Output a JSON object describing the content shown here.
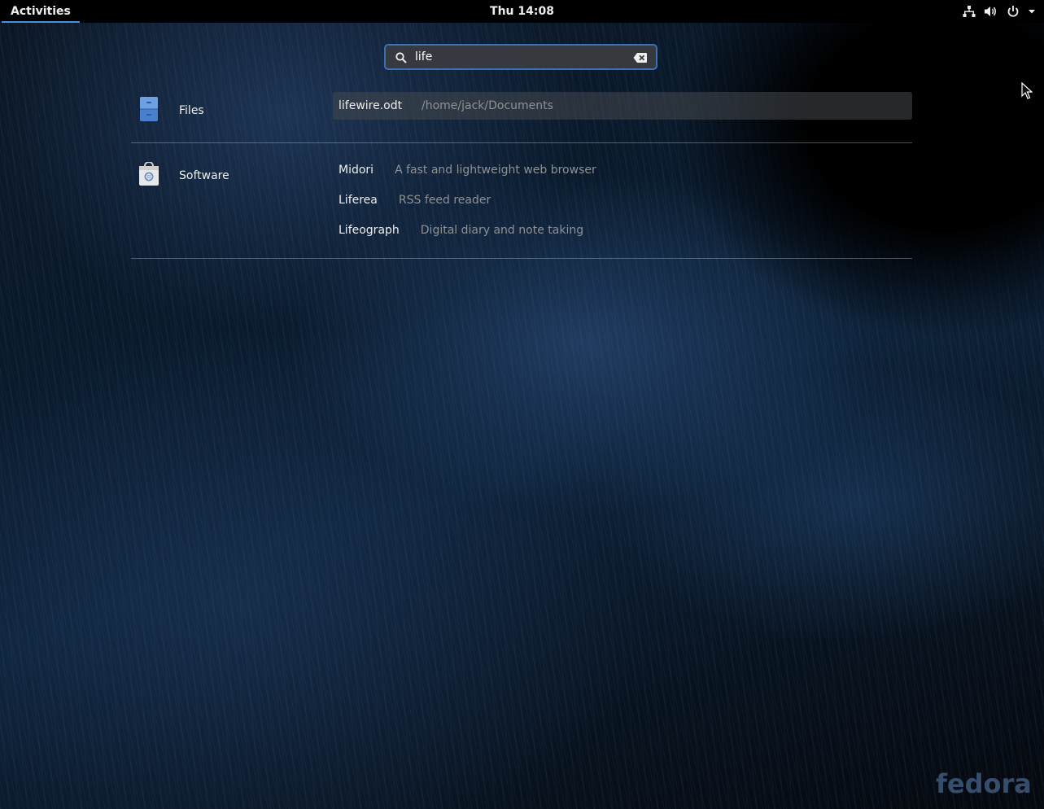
{
  "topbar": {
    "activities": "Activities",
    "clock": "Thu 14:08",
    "tray_icons": [
      "network-icon",
      "volume-icon",
      "power-icon",
      "menu-arrow-icon"
    ]
  },
  "search": {
    "value": "life",
    "icon": "search-icon",
    "clear_icon": "clear-icon"
  },
  "results": {
    "files": {
      "provider": "Files",
      "icon": "files-app-icon",
      "items": [
        {
          "title": "lifewire.odt",
          "description": "/home/jack/Documents"
        }
      ]
    },
    "software": {
      "provider": "Software",
      "icon": "software-app-icon",
      "items": [
        {
          "title": "Midori",
          "description": "A fast and lightweight web browser"
        },
        {
          "title": "Liferea",
          "description": "RSS feed reader"
        },
        {
          "title": "Lifeograph",
          "description": "Digital diary and note taking"
        }
      ]
    }
  },
  "wallpaper": {
    "brand": "fedora"
  },
  "colors": {
    "accent": "#3d6fb5",
    "text": "#eeeeec",
    "muted": "#8f9193"
  }
}
